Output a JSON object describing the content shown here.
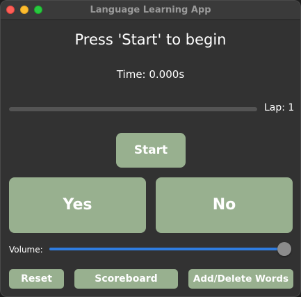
{
  "window": {
    "title": "Language Learning App"
  },
  "main": {
    "prompt": "Press 'Start' to begin",
    "timer": "Time: 0.000s",
    "lap_label": "Lap: 1",
    "progress_fraction": 0
  },
  "buttons": {
    "start": "Start",
    "yes": "Yes",
    "no": "No",
    "reset": "Reset",
    "scoreboard": "Scoreboard",
    "add_delete_words": "Add/Delete Words"
  },
  "volume": {
    "label": "Volume:",
    "level": 1.0
  },
  "colors": {
    "button_bg": "#98b08f",
    "accent": "#2f7de1",
    "window_bg": "#323232"
  }
}
